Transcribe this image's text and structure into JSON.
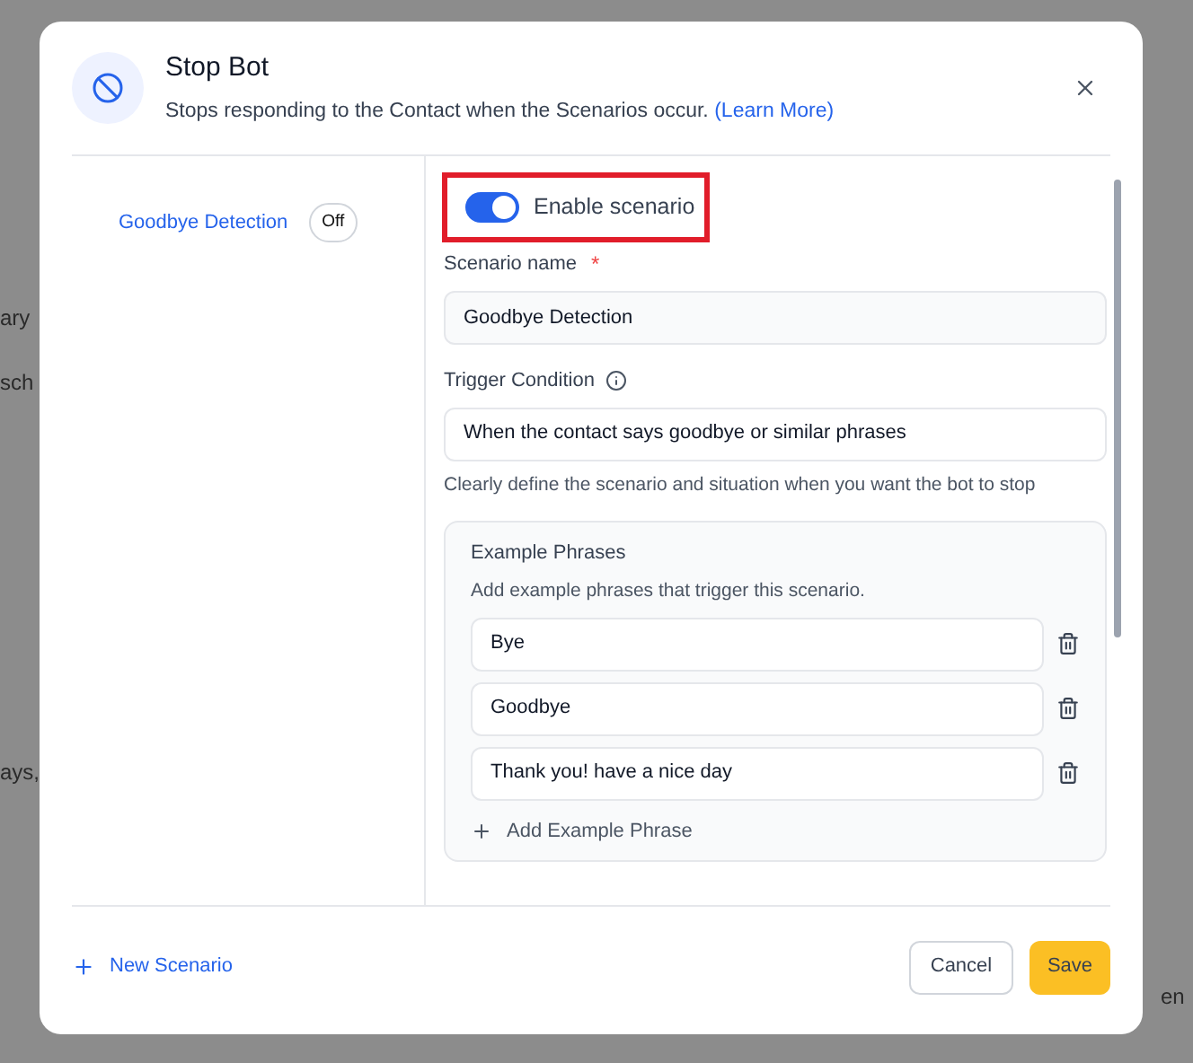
{
  "backdrop": {
    "fragments": [
      "ary",
      "sch",
      "ays,",
      "en"
    ]
  },
  "dialog": {
    "title": "Stop Bot",
    "description": "Stops responding to the Contact when the Scenarios occur.",
    "link": "(Learn More)"
  },
  "scenarios": [
    {
      "name": "Goodbye Detection",
      "status": "Off",
      "selected": true
    }
  ],
  "editor": {
    "enable": {
      "label": "Enable scenario",
      "on": true,
      "highlighted": true
    },
    "name_field": {
      "label": "Scenario name",
      "required_mark": "*",
      "value": "Goodbye Detection"
    },
    "trigger_field": {
      "label": "Trigger Condition",
      "value": "When the contact says goodbye or similar phrases",
      "help": "Clearly define the scenario and situation when you want the bot to stop"
    },
    "phrases": {
      "title": "Example Phrases",
      "hint": "Add example phrases that trigger this scenario.",
      "items": [
        "Bye",
        "Goodbye",
        "Thank you! have a nice day"
      ],
      "add_label": "Add Example Phrase"
    }
  },
  "footer": {
    "new_scenario": "New Scenario",
    "buttons": [
      {
        "label": "Cancel",
        "kind": "secondary"
      },
      {
        "label": "Save",
        "kind": "primary"
      }
    ]
  }
}
